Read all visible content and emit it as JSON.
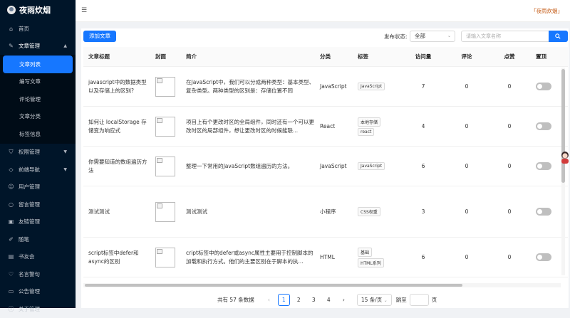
{
  "app": {
    "title": "夜雨炊烟",
    "user": "「夜雨炊烟」"
  },
  "sidebar": {
    "items": [
      {
        "label": "首页",
        "icon": "home-icon"
      },
      {
        "label": "文章管理",
        "icon": "pen-icon",
        "open": true,
        "children": [
          "文章列表",
          "编写文章",
          "评论管理",
          "文章分类",
          "标签信息"
        ],
        "active_child": "文章列表"
      },
      {
        "label": "权限管理",
        "icon": "shield-icon"
      },
      {
        "label": "前端导航",
        "icon": "diamond-icon"
      },
      {
        "label": "用户管理",
        "icon": "user-icon"
      },
      {
        "label": "留言管理",
        "icon": "message-icon"
      },
      {
        "label": "友链管理",
        "icon": "link-icon"
      },
      {
        "label": "随笔",
        "icon": "edit-icon"
      },
      {
        "label": "书友会",
        "icon": "book-icon"
      },
      {
        "label": "名言警句",
        "icon": "heart-icon"
      },
      {
        "label": "公告管理",
        "icon": "notice-icon"
      },
      {
        "label": "关于管理",
        "icon": "info-icon"
      }
    ]
  },
  "toolbar": {
    "add_label": "添加文章",
    "status_label": "发布状态:",
    "status_value": "全部",
    "search_placeholder": "请输入文章名称"
  },
  "table": {
    "headers": [
      "文章标题",
      "封面",
      "简介",
      "分类",
      "标签",
      "访问量",
      "评论",
      "点赞",
      "置顶"
    ],
    "rows": [
      {
        "title": "javascript中的数据类型以及存储上的区别?",
        "intro": "在JavaScript中，我们可以分成两种类型：基本类型、复杂类型。两种类型的区别是：存储位置不同",
        "category": "JavaScript",
        "tags": [
          "JavaScript"
        ],
        "views": "7",
        "comments": "0",
        "likes": "0",
        "top": false
      },
      {
        "title": "如何让 localStorage 存储变为响应式",
        "intro": "项目上有个更改时区的全局组件，同时还有一个可以更改时区的局部组件，想让更改时区的时候能联...",
        "category": "React",
        "tags": [
          "本地存储",
          "react"
        ],
        "views": "4",
        "comments": "0",
        "likes": "0",
        "top": false
      },
      {
        "title": "你需要知道的数组遍历方法",
        "intro": "整理一下常用的JavaScript数组遍历的方法。",
        "category": "JavaScript",
        "tags": [
          "JavaScript"
        ],
        "views": "6",
        "comments": "0",
        "likes": "0",
        "top": false
      },
      {
        "title": "测试测试",
        "intro": "测试测试",
        "category": "小程序",
        "tags": [
          "CSS权重"
        ],
        "views": "3",
        "comments": "0",
        "likes": "0",
        "top": false
      },
      {
        "title": "script标签中defer和async的区别",
        "intro": "cript标签中的defer或async属性主要用于控制脚本的加载和执行方式。他们的主要区别在于脚本的执...",
        "category": "HTML",
        "tags": [
          "基础",
          "HTML系列"
        ],
        "views": "6",
        "comments": "0",
        "likes": "0",
        "top": false
      }
    ]
  },
  "pagination": {
    "total_text": "共有 57 条数据",
    "pages": [
      "1",
      "2",
      "3",
      "4"
    ],
    "current": "1",
    "page_size": "15 条/页",
    "goto_label": "跳至",
    "page_suffix": "页",
    "prev": "‹",
    "next": "›"
  },
  "colors": {
    "primary": "#1677ff",
    "sidebar_bg": "#001529",
    "brand_text": "#c45a14"
  }
}
